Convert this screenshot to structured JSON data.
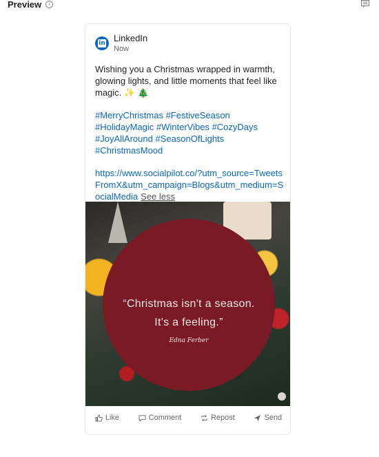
{
  "header": {
    "title": "Preview",
    "info_icon": "info-icon",
    "comment_icon": "comment-icon"
  },
  "post": {
    "account_name": "LinkedIn",
    "time": "Now",
    "avatar_letters": "in",
    "text": "Wishing you a Christmas wrapped in warmth, glowing lights, and little moments that feel like magic. ✨ 🎄",
    "hashtags": "#MerryChristmas #FestiveSeason #HolidayMagic #WinterVibes #CozyDays #JoyAllAround #SeasonOfLights #ChristmasMood",
    "link": "https://www.socialpilot.co/?utm_source=TweetsFromX&utm_campaign=Blogs&utm_medium=SocialMedia",
    "see_less": "See less",
    "image": {
      "quote_line1": "“Christmas isn't a season.",
      "quote_line2": "It's a feeling.”",
      "author": "Edna Ferber",
      "circle_color": "#7a1a24"
    }
  },
  "actions": {
    "like": "Like",
    "comment": "Comment",
    "repost": "Repost",
    "send": "Send"
  },
  "colors": {
    "link": "#0a66c2",
    "brand": "#0a66c2"
  }
}
